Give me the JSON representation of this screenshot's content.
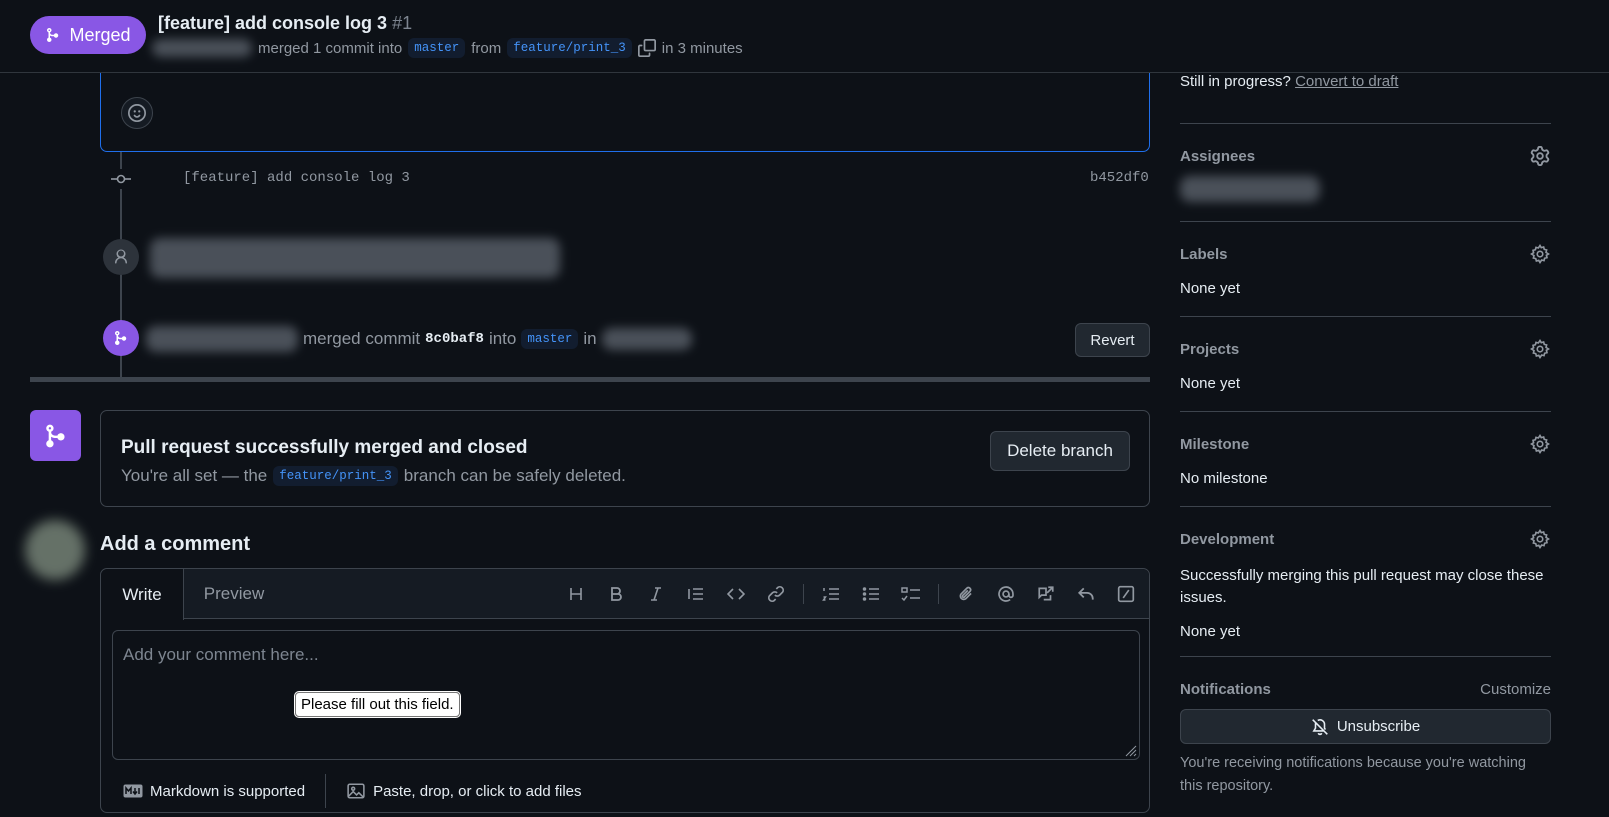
{
  "header": {
    "status_label": "Merged",
    "title": "[feature] add console log 3",
    "number": "#1",
    "merged_text": "merged 1 commit into",
    "base_branch": "master",
    "from_text": "from",
    "head_branch": "feature/print_3",
    "time_text": "in 3 minutes"
  },
  "timeline": {
    "commit_message": "[feature] add console log 3",
    "commit_sha": "b452df0",
    "merge_text": "merged commit",
    "merge_sha": "8c0baf8",
    "merge_into": "into",
    "merge_branch": "master",
    "merge_in": "in",
    "revert_label": "Revert"
  },
  "merge_status": {
    "title": "Pull request successfully merged and closed",
    "desc_before": "You're all set — the",
    "branch": "feature/print_3",
    "desc_after": "branch can be safely deleted.",
    "delete_label": "Delete branch"
  },
  "comment": {
    "heading": "Add a comment",
    "tab_write": "Write",
    "tab_preview": "Preview",
    "placeholder": "Add your comment here...",
    "tooltip": "Please fill out this field.",
    "markdown_note": "Markdown is supported",
    "attach_note": "Paste, drop, or click to add files"
  },
  "sidebar": {
    "draft_text": "Still in progress?",
    "draft_link": "Convert to draft",
    "assignees": {
      "heading": "Assignees"
    },
    "labels": {
      "heading": "Labels",
      "value": "None yet"
    },
    "projects": {
      "heading": "Projects",
      "value": "None yet"
    },
    "milestone": {
      "heading": "Milestone",
      "value": "No milestone"
    },
    "development": {
      "heading": "Development",
      "note": "Successfully merging this pull request may close these issues.",
      "value": "None yet"
    },
    "notifications": {
      "heading": "Notifications",
      "customize": "Customize",
      "unsubscribe": "Unsubscribe",
      "note": "You're receiving notifications because you're watching this repository."
    }
  },
  "colors": {
    "background": "#0d1117",
    "merged_purple": "#8957e5",
    "border": "#3d444d",
    "muted_text": "#9198a1",
    "link_blue": "#4493f8"
  },
  "icons": [
    "git-merge-icon",
    "copy-icon",
    "smiley-icon",
    "git-commit-icon",
    "person-icon",
    "gear-icon",
    "bell-slash-icon",
    "markdown-icon",
    "image-icon"
  ]
}
